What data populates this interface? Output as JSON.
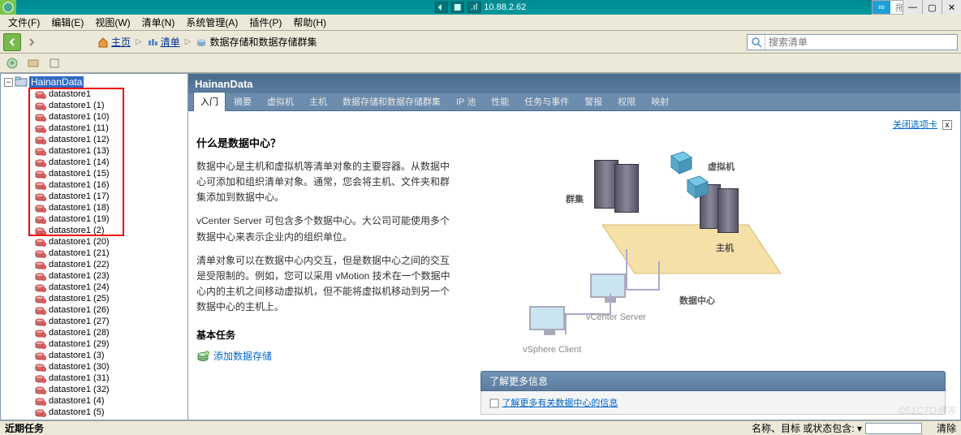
{
  "titlebar": {
    "address": "10.88.2.62",
    "upload_label": "拖拽上传"
  },
  "menubar": [
    "文件(F)",
    "编辑(E)",
    "视图(W)",
    "清单(N)",
    "系统管理(A)",
    "插件(P)",
    "帮助(H)"
  ],
  "breadcrumb": {
    "home_label": "主页",
    "inventory_label": "清单",
    "current_label": "数据存储和数据存储群集"
  },
  "search": {
    "placeholder": "搜索清单"
  },
  "tree": {
    "root_label": "HainanData",
    "datastores": [
      "datastore1",
      "datastore1 (1)",
      "datastore1 (10)",
      "datastore1 (11)",
      "datastore1 (12)",
      "datastore1 (13)",
      "datastore1 (14)",
      "datastore1 (15)",
      "datastore1 (16)",
      "datastore1 (17)",
      "datastore1 (18)",
      "datastore1 (19)",
      "datastore1 (2)",
      "datastore1 (20)",
      "datastore1 (21)",
      "datastore1 (22)",
      "datastore1 (23)",
      "datastore1 (24)",
      "datastore1 (25)",
      "datastore1 (26)",
      "datastore1 (27)",
      "datastore1 (28)",
      "datastore1 (29)",
      "datastore1 (3)",
      "datastore1 (30)",
      "datastore1 (31)",
      "datastore1 (32)",
      "datastore1 (4)",
      "datastore1 (5)"
    ]
  },
  "detail": {
    "header_title": "HainanData",
    "tabs": [
      "入门",
      "摘要",
      "虚拟机",
      "主机",
      "数据存储和数据存储群集",
      "IP 池",
      "性能",
      "任务与事件",
      "警报",
      "权限",
      "映射"
    ],
    "active_tab": 0,
    "close_tab_label": "关闭选项卡",
    "content": {
      "heading": "什么是数据中心？",
      "p1": "数据中心是主机和虚拟机等清单对象的主要容器。从数据中心可添加和组织清单对象。通常，您会将主机、文件夹和群集添加到数据中心。",
      "p2": "vCenter Server 可包含多个数据中心。大公司可能使用多个数据中心来表示企业内的组织单位。",
      "p3": "清单对象可以在数据中心内交互，但是数据中心之间的交互是受限制的。例如，您可以采用 vMotion 技术在一个数据中心内的主机之间移动虚拟机，但不能将虚拟机移动到另一个数据中心的主机上。",
      "tasks_heading": "基本任务",
      "task_link": "添加数据存储",
      "diagram_labels": {
        "cluster": "群集",
        "vm": "虚拟机",
        "host": "主机",
        "datacenter": "数据中心",
        "vcenter": "vCenter Server",
        "client": "vSphere Client"
      },
      "learn_more_title": "了解更多信息",
      "learn_more_link": "了解更多有关数据中心的信息"
    }
  },
  "statusbar": {
    "recent_tasks": "近期任务",
    "filter_label": "名称、目标 或状态包含: ▾",
    "clear_label": "清除"
  },
  "watermark": "©51CTO博客"
}
